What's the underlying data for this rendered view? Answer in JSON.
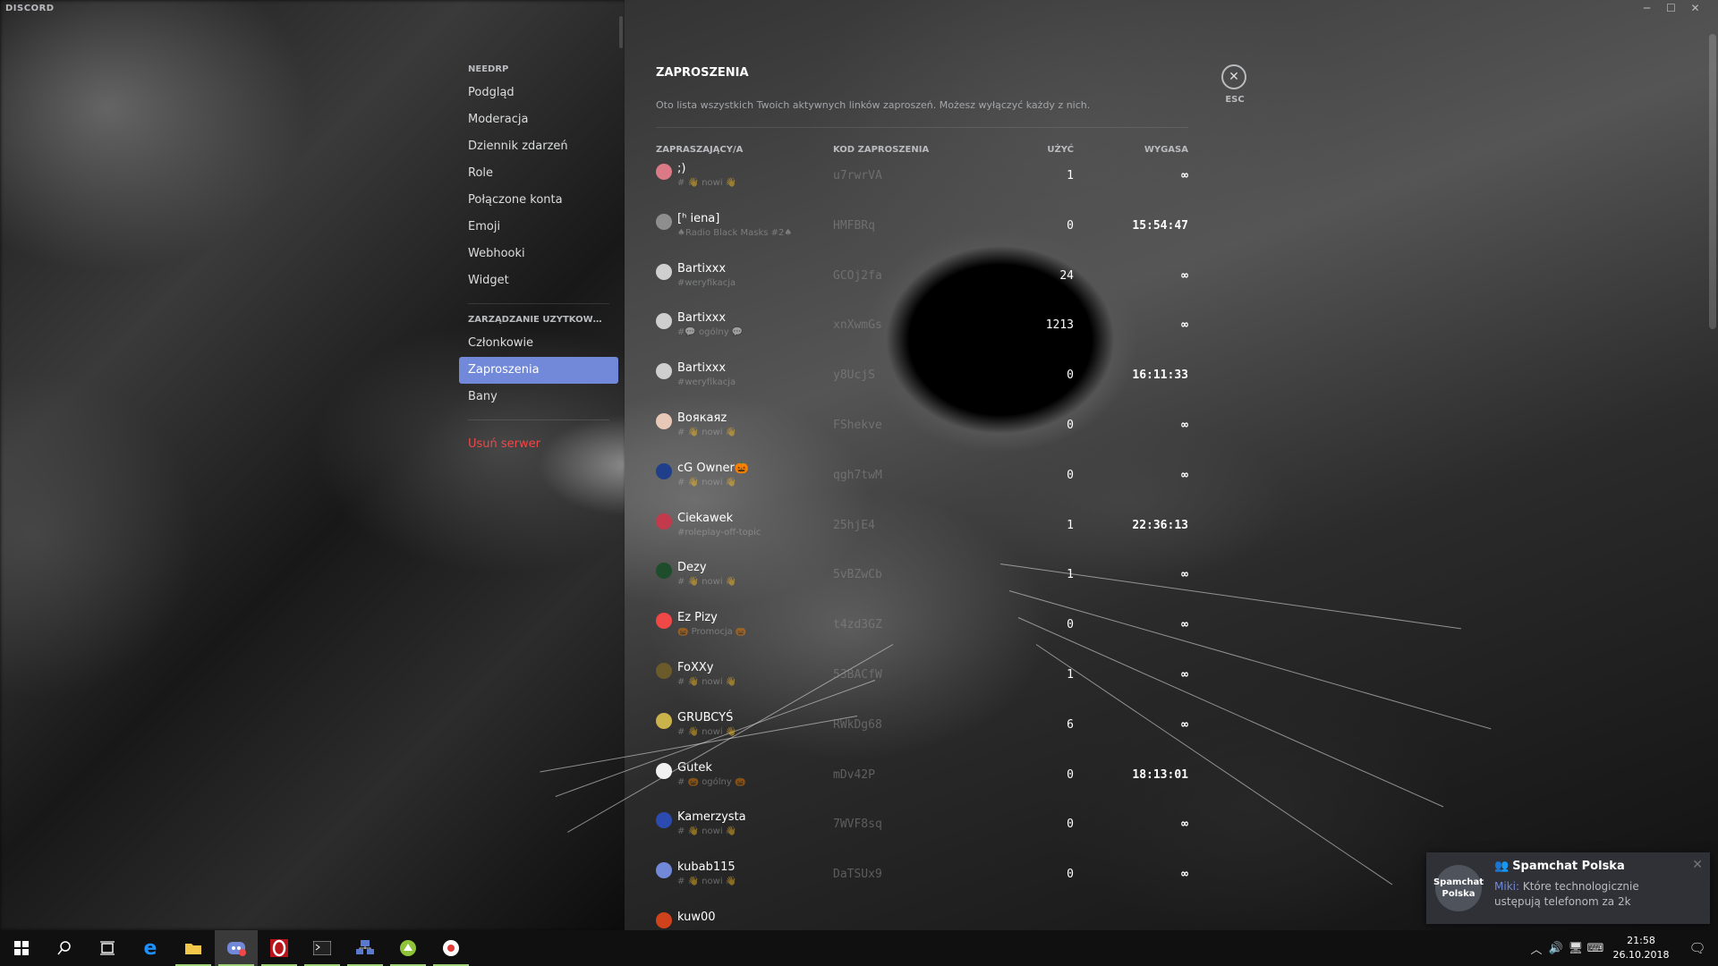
{
  "window": {
    "app_title": "DISCORD",
    "controls": [
      "─",
      "☐",
      "✕"
    ]
  },
  "sidebar": {
    "server_header": "NEEDRP",
    "items": [
      "Podgląd",
      "Moderacja",
      "Dziennik zdarzeń",
      "Role",
      "Połączone konta",
      "Emoji",
      "Webhooki",
      "Widget"
    ],
    "users_header": "ZARZĄDZANIE UŻYTKOWNIK...",
    "user_items": [
      "Członkowie",
      "Zaproszenia",
      "Bany"
    ],
    "active_item": "Zaproszenia",
    "delete_server": "Usuń serwer"
  },
  "content": {
    "title": "ZAPROSZENIA",
    "description": "Oto lista wszystkich Twoich aktywnych linków zaproszeń. Możesz wyłączyć każdy z nich.",
    "columns": {
      "inviter": "ZAPRASZAJĄCY/A",
      "code": "KOD ZAPROSZENIA",
      "uses": "UŻYĆ",
      "expires": "WYGASA"
    },
    "invites": [
      {
        "name": ";)",
        "channel": "# 👋 nowi 👋",
        "code": "u7rwrVA",
        "uses": "1",
        "expires": "∞",
        "avatar_color": "#d97a86"
      },
      {
        "name": "[ʰ iena]",
        "channel": "♠Radio Black Masks #2♠",
        "code": "HMFBRq",
        "uses": "0",
        "expires": "15:54:47",
        "avatar_color": "#8e8e8e"
      },
      {
        "name": "Bartixxx",
        "channel": "#weryfikacja",
        "code": "GCOj2fa",
        "uses": "24",
        "expires": "∞",
        "avatar_color": "#cfcfcf"
      },
      {
        "name": "Bartixxx",
        "channel": "#💬 ogólny 💬",
        "code": "xnXwmGs",
        "uses": "1213",
        "expires": "∞",
        "avatar_color": "#cfcfcf"
      },
      {
        "name": "Bartixxx",
        "channel": "#weryfikacja",
        "code": "y8UcjS",
        "uses": "0",
        "expires": "16:11:33",
        "avatar_color": "#cfcfcf"
      },
      {
        "name": "Воякаяz",
        "channel": "# 👋 nowi 👋",
        "code": "FShekve",
        "uses": "0",
        "expires": "∞",
        "avatar_color": "#e8c9b8"
      },
      {
        "name": "cG Owner🎃",
        "channel": "# 👋 nowi 👋",
        "code": "qgh7twM",
        "uses": "0",
        "expires": "∞",
        "avatar_color": "#1f3f8a"
      },
      {
        "name": "Ciekawek",
        "channel": "#roleplay-off-topic",
        "code": "25hjE4",
        "uses": "1",
        "expires": "22:36:13",
        "avatar_color": "#c23a4b"
      },
      {
        "name": "Dezy",
        "channel": "# 👋 nowi 👋",
        "code": "5vBZwCb",
        "uses": "1",
        "expires": "∞",
        "avatar_color": "#1e4d2b"
      },
      {
        "name": "Ez Pizy",
        "channel": "🎃 Promocja 🎃",
        "code": "t4zd3GZ",
        "uses": "0",
        "expires": "∞",
        "avatar_color": "#f04747"
      },
      {
        "name": "FoXXy",
        "channel": "# 👋 nowi 👋",
        "code": "53BACfW",
        "uses": "1",
        "expires": "∞",
        "avatar_color": "#6b5a2a"
      },
      {
        "name": "GRUBCYŚ",
        "channel": "# 👋 nowi 👋",
        "code": "RWkDg68",
        "uses": "6",
        "expires": "∞",
        "avatar_color": "#c9b34a"
      },
      {
        "name": "Gutek",
        "channel": "# 🎃 ogólny 🎃",
        "code": "mDv42P",
        "uses": "0",
        "expires": "18:13:01",
        "avatar_color": "#f2f2f2"
      },
      {
        "name": "Kamerzysta",
        "channel": "# 👋 nowi 👋",
        "code": "7WVF8sq",
        "uses": "0",
        "expires": "∞",
        "avatar_color": "#2c4bb0"
      },
      {
        "name": "kubab115",
        "channel": "# 👋 nowi 👋",
        "code": "DaTSUx9",
        "uses": "0",
        "expires": "∞",
        "avatar_color": "#7289da"
      },
      {
        "name": "kuw00",
        "channel": "",
        "code": "",
        "uses": "",
        "expires": "",
        "avatar_color": "#d0421b"
      }
    ]
  },
  "close": {
    "icon": "✕",
    "label": "ESC"
  },
  "toast": {
    "avatar_text": "Spamchat Polska",
    "server": "Spamchat Polska",
    "author": "Miki:",
    "message": "Które technologicznie ustępują telefonom za 2k",
    "close_icon": "✕"
  },
  "taskbar": {
    "apps": [
      "windows-start-icon",
      "search-icon",
      "task-view-icon",
      "edge-icon",
      "file-explorer-icon",
      "discord-icon",
      "opera-icon",
      "terminal-icon",
      "network-app-icon",
      "browser-green-icon",
      "media-app-icon"
    ],
    "time": "21:58",
    "date": "26.10.2018"
  }
}
